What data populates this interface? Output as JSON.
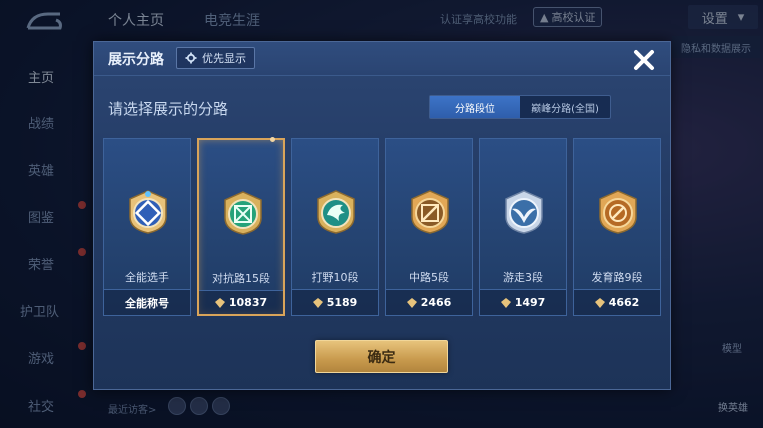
{
  "background": {
    "top_tabs": [
      "个人主页",
      "电竞生涯"
    ],
    "verify_text": "认证享高校功能",
    "campus_badge": "高校认证",
    "settings_label": "设置",
    "right_peek_text": "隐私和数据展示",
    "side_nav": [
      "主页",
      "战绩",
      "英雄",
      "图鉴",
      "荣誉",
      "护卫队",
      "游戏",
      "社交"
    ],
    "recent_visit": "最近访客>",
    "bottom_right_1": "模型",
    "bottom_right_2": "换英雄"
  },
  "modal": {
    "title": "展示分路",
    "priority_label": "优先显示",
    "subtitle": "请选择展示的分路",
    "tabs": [
      {
        "label": "分路段位",
        "active": true
      },
      {
        "label": "巅峰分路(全国)",
        "active": false
      }
    ],
    "cards": [
      {
        "rank": "全能选手",
        "stat": "全能称号",
        "icon": "all-round-emblem-icon",
        "selected": false,
        "has_gem": false
      },
      {
        "rank": "对抗路15段",
        "stat": "10837",
        "icon": "clash-lane-emblem-icon",
        "selected": true,
        "has_gem": true
      },
      {
        "rank": "打野10段",
        "stat": "5189",
        "icon": "jungle-emblem-icon",
        "selected": false,
        "has_gem": true
      },
      {
        "rank": "中路5段",
        "stat": "2466",
        "icon": "mid-lane-emblem-icon",
        "selected": false,
        "has_gem": true
      },
      {
        "rank": "游走3段",
        "stat": "1497",
        "icon": "roam-emblem-icon",
        "selected": false,
        "has_gem": true
      },
      {
        "rank": "发育路9段",
        "stat": "4662",
        "icon": "farm-lane-emblem-icon",
        "selected": false,
        "has_gem": true
      }
    ],
    "confirm_label": "确定"
  },
  "colors": {
    "accent_gold": "#d9a45a",
    "tab_active": "#3d73c7",
    "modal_bg": "#243c66"
  }
}
